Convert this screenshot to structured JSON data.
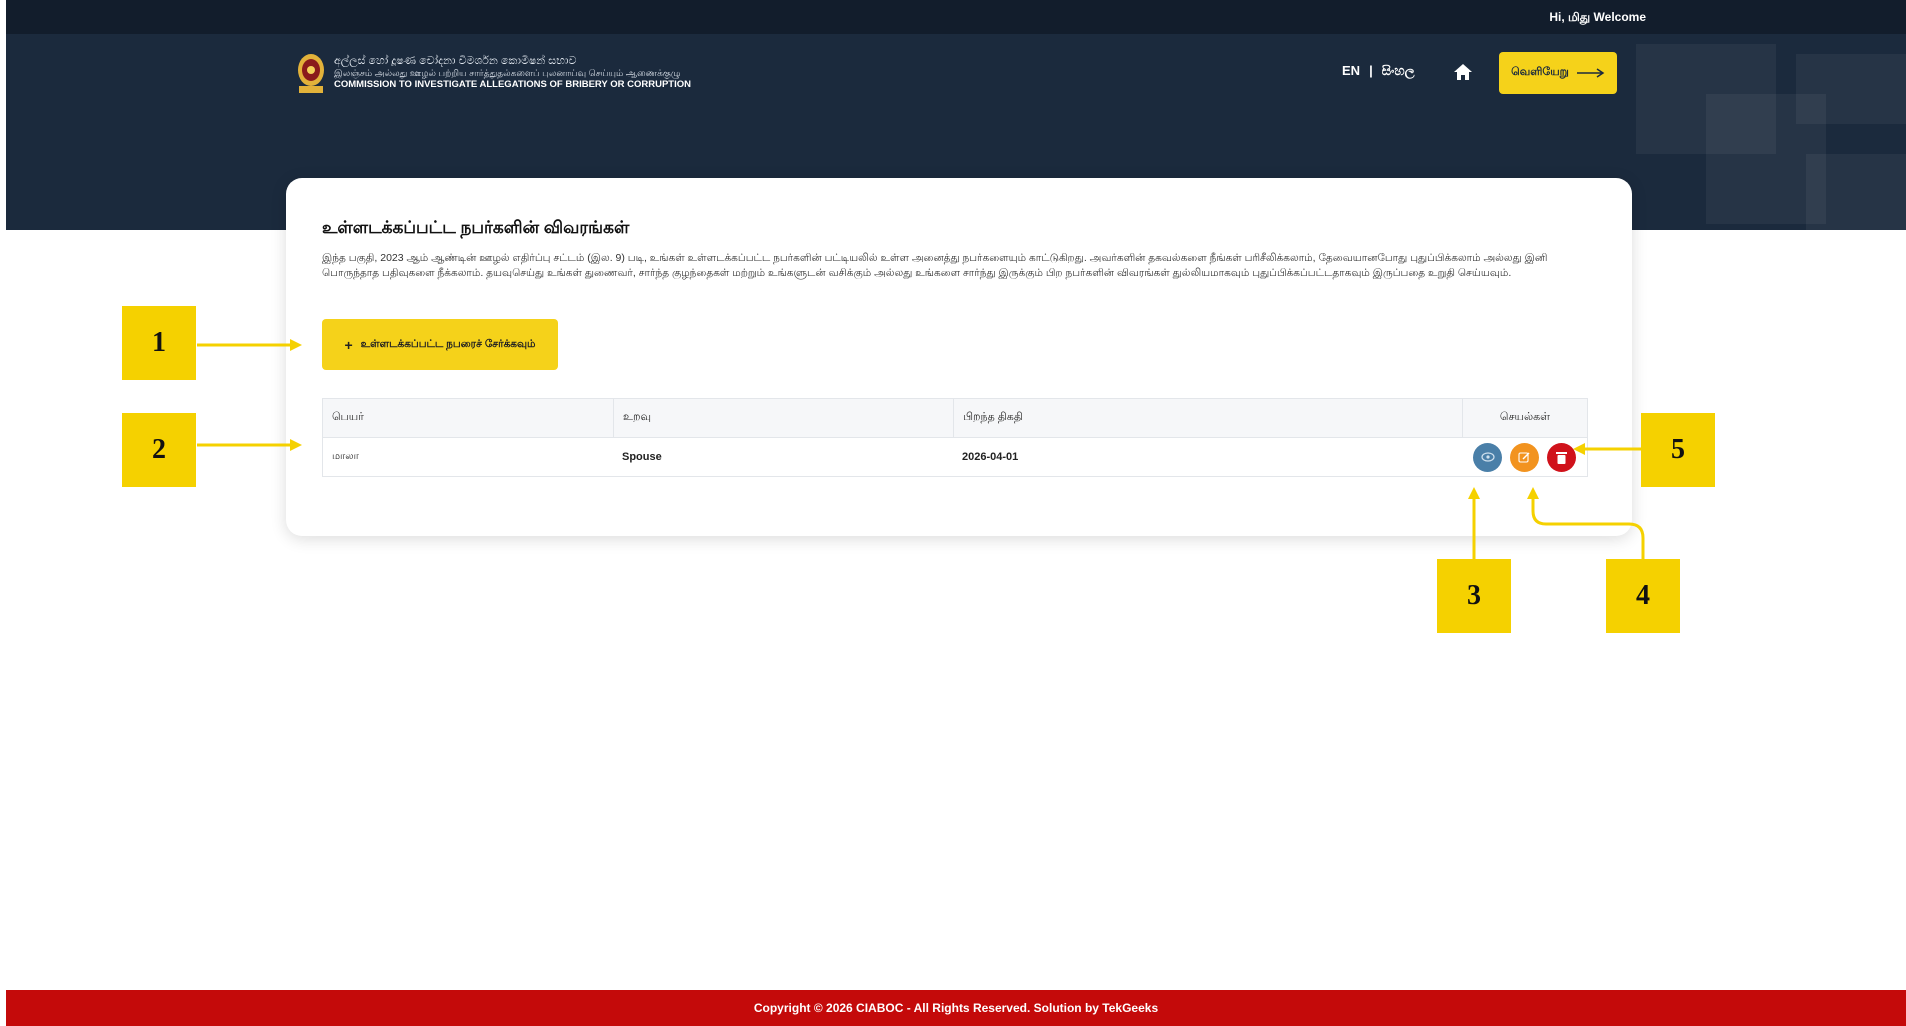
{
  "topbar": {
    "welcome": "Hi, மிது Welcome"
  },
  "brand": {
    "line1": "අල්ලස් හෝ දූෂණ චෝදනා විමර්ශන කොමිෂන් සභාව",
    "line2": "இலஞ்சம் அல்லது ஊழல் பற்றிய சார்த்துதல்களைப் புலனாய்வு செய்யும் ஆணைக்குழு",
    "line3": "COMMISSION TO INVESTIGATE ALLEGATIONS OF BRIBERY OR CORRUPTION"
  },
  "nav": {
    "lang_en": "EN",
    "separator": "|",
    "lang_si": "සිංහල",
    "logout_label": "வெளியேறு"
  },
  "page": {
    "title": "உள்ளடக்கப்பட்ட நபர்களின் விவரங்கள்",
    "description": "இந்த பகுதி, 2023 ஆம் ஆண்டின் ஊழல் எதிர்ப்பு சட்டம் (இல. 9) படி, உங்கள் உள்ளடக்கப்பட்ட நபர்களின் பட்டியலில் உள்ள அனைத்து நபர்களையும் காட்டுகிறது. அவர்களின் தகவல்களை நீங்கள் பரிசீலிக்கலாம், தேவையானபோது புதுப்பிக்கலாம் அல்லது இனி பொருந்தாத பதிவுகளை நீக்கலாம். தயவுசெய்து உங்கள் துணைவர், சார்ந்த குழந்தைகள் மற்றும் உங்களுடன் வசிக்கும் அல்லது உங்களை சார்ந்து இருக்கும் பிற நபர்களின் விவரங்கள் துல்லியமாகவும் புதுப்பிக்கப்பட்டதாகவும் இருப்பதை உறுதி செய்யவும்.",
    "add_button": "உள்ளடக்கப்பட்ட நபரைச் சேர்க்கவும்"
  },
  "table": {
    "headers": [
      "பெயர்",
      "உறவு",
      "பிறந்த திகதி",
      "செயல்கள்"
    ],
    "rows": [
      {
        "name": "மாலா",
        "relation": "Spouse",
        "dob": "2026-04-01"
      }
    ]
  },
  "footer": {
    "text": "Copyright © 2026 CIABOC - All Rights Reserved. Solution by TekGeeks"
  },
  "annotations": {
    "m1": "1",
    "m2": "2",
    "m3": "3",
    "m4": "4",
    "m5": "5"
  },
  "colors": {
    "header": "#1b2a3d",
    "accent": "#f5d21a",
    "footer": "#c40a0a",
    "view": "#4a7fa8",
    "edit": "#f2931f",
    "delete": "#d0121b"
  },
  "icons": [
    "home-icon",
    "arrow-right-icon",
    "plus-icon",
    "eye-icon",
    "edit-icon",
    "trash-icon",
    "emblem-logo"
  ]
}
